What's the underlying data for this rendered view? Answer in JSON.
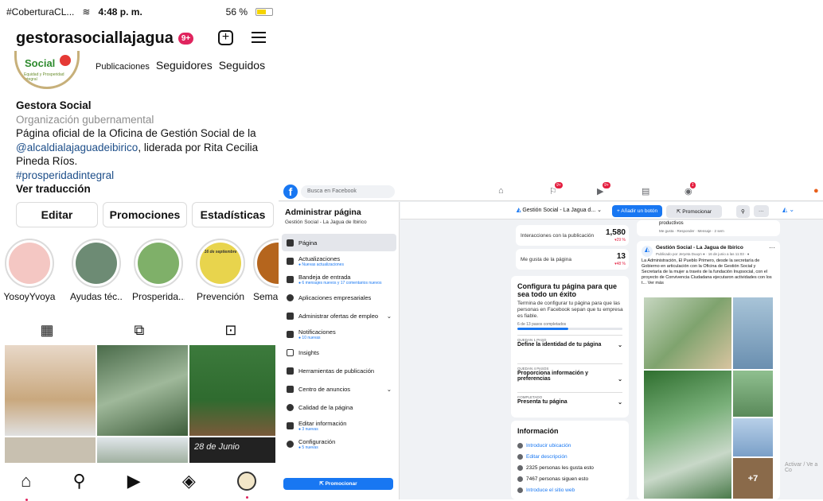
{
  "instagram": {
    "status": {
      "carrier": "#CoberturaCL...",
      "time": "4:48 p. m.",
      "battery": "56 %"
    },
    "username": "gestorasociallajagua",
    "notif_badge": "9+",
    "logo_text": "Social",
    "logo_sub": "Equidad y Prosperidad Integral",
    "stats": [
      "Publicaciones",
      "Seguidores",
      "Seguidos"
    ],
    "name": "Gestora Social",
    "category": "Organización gubernamental",
    "bio1": "Página oficial de la Oficina de Gestión Social de la",
    "mention": "@alcaldialajaguadeibirico",
    "bio2": ", liderada por Rita Cecilia Pineda Ríos.",
    "hashtag": "#prosperidadintegral",
    "translate": "Ver traducción",
    "buttons": {
      "edit": "Editar",
      "promo": "Promociones",
      "stats": "Estadísticas"
    },
    "highlights": [
      {
        "label": "YosoyYvoya",
        "color": "#f4c7c3"
      },
      {
        "label": "Ayudas téc...",
        "color": "#6d8b74"
      },
      {
        "label": "Prosperida...",
        "color": "#7fb069"
      },
      {
        "label": "Prevención",
        "color": "#e8d44d"
      },
      {
        "label": "Seman",
        "color": "#b5651d"
      }
    ],
    "hl_sep": "16 de septiembre",
    "grid_text": "28 de Junio"
  },
  "facebook": {
    "search_placeholder": "Busca en Facebook",
    "nav_badges": [
      "9+",
      "9+",
      "1"
    ],
    "side_title": "Administrar página",
    "side_sub": "Gestión Social - La Jagua de Ibirico",
    "side_items": [
      {
        "label": "Página",
        "sub": ""
      },
      {
        "label": "Actualizaciones",
        "sub": "● Nuevas actualizaciones"
      },
      {
        "label": "Bandeja de entrada",
        "sub": "● 6 mensajes nuevos y 17 comentarios nuevos"
      },
      {
        "label": "Aplicaciones empresariales",
        "sub": ""
      },
      {
        "label": "Administrar ofertas de empleo",
        "sub": ""
      },
      {
        "label": "Notificaciones",
        "sub": "● 10 nuevas"
      },
      {
        "label": "Insights",
        "sub": ""
      },
      {
        "label": "Herramientas de publicación",
        "sub": ""
      },
      {
        "label": "Centro de anuncios",
        "sub": ""
      },
      {
        "label": "Calidad de la página",
        "sub": ""
      },
      {
        "label": "Editar información",
        "sub": "● 3 nuevas"
      },
      {
        "label": "Configuración",
        "sub": "● 5 nuevas"
      }
    ],
    "promote": "Promocionar",
    "bar": {
      "page": "Gestión Social - La Jagua d...",
      "add": "+ Añadir un botón",
      "promo": "Promocionar"
    },
    "metrics": [
      {
        "label": "Interacciones con la publicación",
        "value": "1,580",
        "delta": "▾29 %"
      },
      {
        "label": "Me gusta de la página",
        "value": "13",
        "delta": "▾48 %"
      }
    ],
    "setup": {
      "title": "Configura tu página para que sea todo un éxito",
      "desc": "Termina de configurar tu página para que las personas en Facebook sepan que tu empresa es fiable.",
      "progress": "6 de 13 pasos completados",
      "steps": [
        {
          "tag": "QUEDAN 1 PASO",
          "label": "Define la identidad de tu página"
        },
        {
          "tag": "QUEDAN 4 PASOS",
          "label": "Proporciona información y preferencias"
        },
        {
          "tag": "COMPLETADO",
          "label": "Presenta tu página"
        }
      ]
    },
    "info": {
      "title": "Información",
      "items": [
        "Introducir ubicación",
        "Editar descripción",
        "2325 personas les gusta esto",
        "7467 personas siguen esto",
        "Introduce el sitio web"
      ]
    },
    "post": {
      "top": "productivos",
      "top_meta": "Me gusta · Responder · Mensaje · 2 sem",
      "author": "Gestión Social - La Jagua de Ibirico",
      "meta": "Publicado por Jeryeta Duuyn ● · 16 de junio a las 11:03 · ●",
      "text": "La Administración, El Pueblo Primero, desde la secretaría de Gobierno en articulación con la Oficina de Gestión Social y Secretaría de la mujer a través de la fundación Inupsocial, con el proyecto de Convivencia Ciudadana ejecutaron actividades con los t... Ver más",
      "more": "+7"
    },
    "watermark": "Activar / Ve a Co"
  }
}
